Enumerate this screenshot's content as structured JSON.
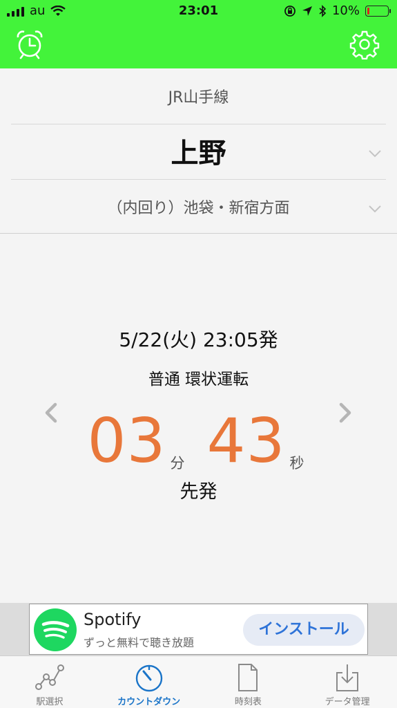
{
  "status_bar": {
    "carrier": "au",
    "time": "23:01",
    "battery_percent": "10%",
    "battery_level": 0.1
  },
  "header": {
    "left_icon": "alarm-clock-icon",
    "right_icon": "gear-icon",
    "accent_color": "#43f33a"
  },
  "route": {
    "line_name": "JR山手線",
    "station": "上野",
    "direction": "（内回り）池袋・新宿方面"
  },
  "countdown": {
    "departure": "5/22(火)  23:05発",
    "train_type": "普通 環状運転",
    "minutes": "03",
    "minutes_unit": "分",
    "seconds": "43",
    "seconds_unit": "秒",
    "note": "先発",
    "number_color": "#e8773a"
  },
  "ad": {
    "title": "Spotify",
    "subtitle": "ずっと無料で聴き放題",
    "button_label": "インストール"
  },
  "tabs": [
    {
      "label": "駅選択",
      "icon": "route-graph-icon",
      "active": false
    },
    {
      "label": "カウントダウン",
      "icon": "timer-icon",
      "active": true
    },
    {
      "label": "時刻表",
      "icon": "document-icon",
      "active": false
    },
    {
      "label": "データ管理",
      "icon": "download-tray-icon",
      "active": false
    }
  ]
}
